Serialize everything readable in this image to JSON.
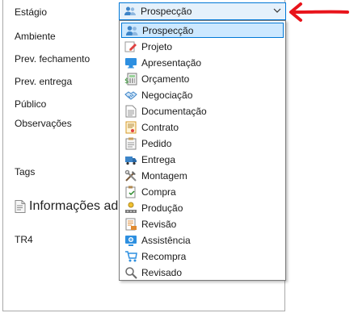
{
  "form": {
    "labels": {
      "estagio": "Estágio",
      "ambiente": "Ambiente",
      "prev_fechamento": "Prev. fechamento",
      "prev_entrega": "Prev. entrega",
      "publico": "Público",
      "observacoes": "Observações",
      "tags": "Tags",
      "tr4": "TR4"
    },
    "section_title": "Informações ad"
  },
  "stage_select": {
    "value": "Prospecção",
    "options": [
      {
        "label": "Prospecção",
        "icon": "people-icon",
        "selected": true
      },
      {
        "label": "Projeto",
        "icon": "pencil-icon"
      },
      {
        "label": "Apresentação",
        "icon": "monitor-icon"
      },
      {
        "label": "Orçamento",
        "icon": "calculator-icon"
      },
      {
        "label": "Negociação",
        "icon": "handshake-icon"
      },
      {
        "label": "Documentação",
        "icon": "document-icon"
      },
      {
        "label": "Contrato",
        "icon": "contract-icon"
      },
      {
        "label": "Pedido",
        "icon": "order-icon"
      },
      {
        "label": "Entrega",
        "icon": "truck-icon"
      },
      {
        "label": "Montagem",
        "icon": "tools-icon"
      },
      {
        "label": "Compra",
        "icon": "clipboard-icon"
      },
      {
        "label": "Produção",
        "icon": "production-icon"
      },
      {
        "label": "Revisão",
        "icon": "review-icon"
      },
      {
        "label": "Assistência",
        "icon": "support-icon"
      },
      {
        "label": "Recompra",
        "icon": "cart-icon"
      },
      {
        "label": "Revisado",
        "icon": "magnifier-icon"
      }
    ]
  },
  "colors": {
    "selection": "#cce8ff",
    "focus_border": "#0078d7",
    "annotation_arrow": "#e8141b"
  }
}
